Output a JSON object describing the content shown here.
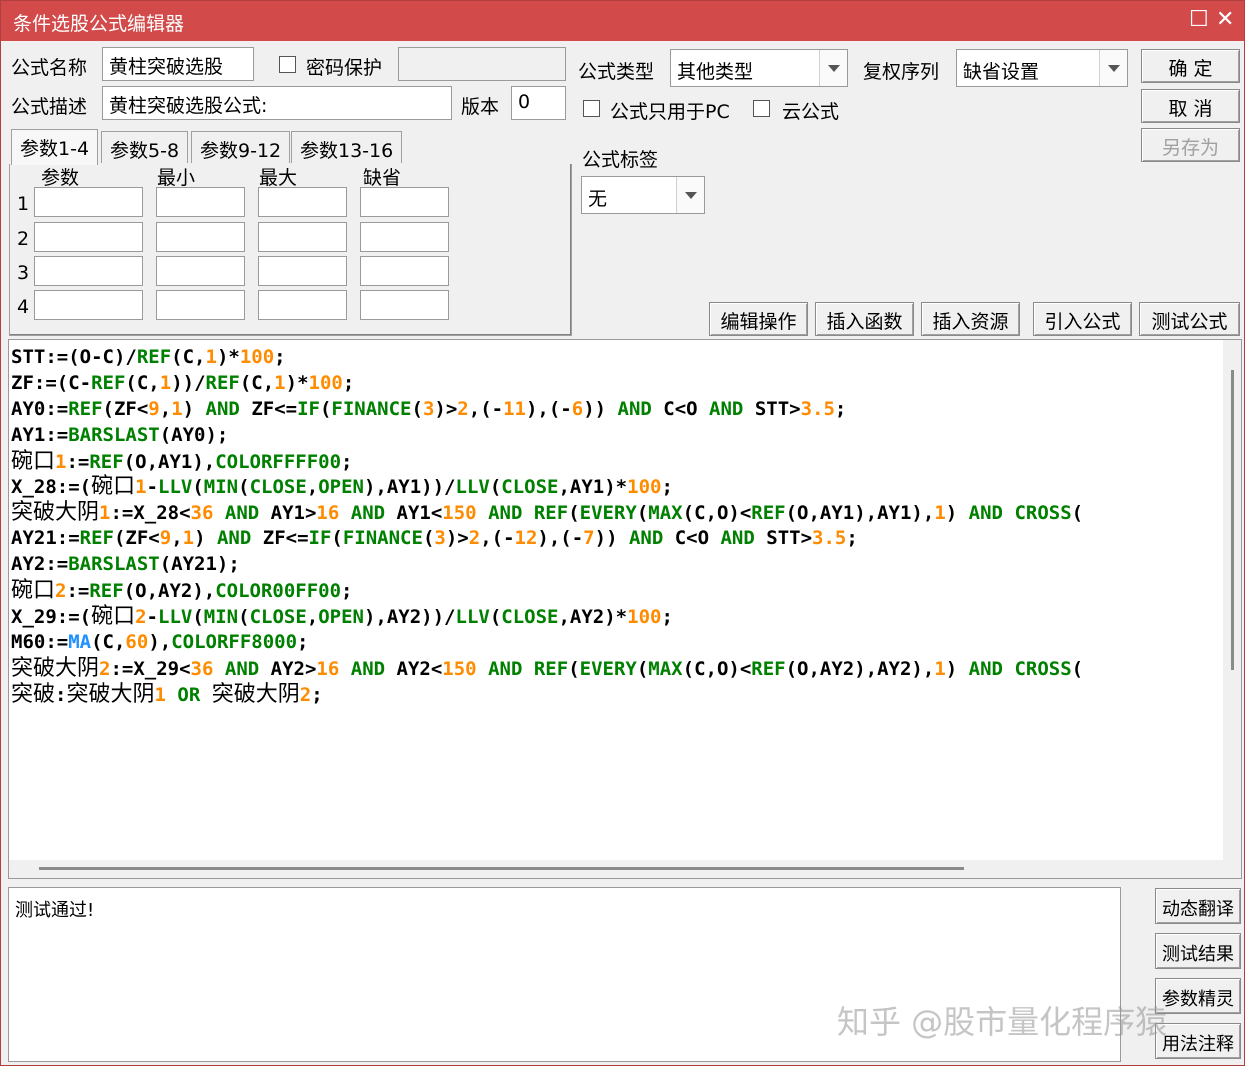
{
  "window": {
    "title": "条件选股公式编辑器"
  },
  "form": {
    "name_label": "公式名称",
    "name_value": "黄柱突破选股",
    "password_label": "密码保护",
    "password_value": "",
    "desc_label": "公式描述",
    "desc_value": "黄柱突破选股公式:",
    "version_label": "版本",
    "version_value": "0",
    "type_label": "公式类型",
    "type_value": "其他类型",
    "adjust_label": "复权序列",
    "adjust_value": "缺省设置",
    "pc_only_label": "公式只用于PC",
    "cloud_label": "云公式",
    "tag_label": "公式标签",
    "tag_value": "无"
  },
  "buttons": {
    "ok": "确  定",
    "cancel": "取  消",
    "save_as": "另存为",
    "edit_ops": "编辑操作",
    "insert_func": "插入函数",
    "insert_res": "插入资源",
    "import_formula": "引入公式",
    "test_formula": "测试公式",
    "dyn_translate": "动态翻译",
    "test_result": "测试结果",
    "param_wizard": "参数精灵",
    "usage_notes": "用法注释"
  },
  "tabs": [
    "参数1-4",
    "参数5-8",
    "参数9-12",
    "参数13-16"
  ],
  "params": {
    "headers": [
      "参数",
      "最小",
      "最大",
      "缺省"
    ],
    "rows": [
      "1",
      "2",
      "3",
      "4"
    ]
  },
  "code_lines": [
    "STT:=(O-C)/REF(C,1)*100;",
    "ZF:=(C-REF(C,1))/REF(C,1)*100;",
    "AY0:=REF(ZF<9,1) AND ZF<=IF(FINANCE(3)>2,(-11),(-6)) AND C<O AND STT>3.5;",
    "AY1:=BARSLAST(AY0);",
    "碗口1:=REF(O,AY1),COLORFFFF00;",
    "X_28:=(碗口1-LLV(MIN(CLOSE,OPEN),AY1))/LLV(CLOSE,AY1)*100;",
    "突破大阴1:=X_28<36 AND AY1>16 AND AY1<150 AND REF(EVERY(MAX(C,O)<REF(O,AY1),AY1),1) AND CROSS(",
    "AY21:=REF(ZF<9,1) AND ZF<=IF(FINANCE(3)>2,(-12),(-7)) AND C<O AND STT>3.5;",
    "AY2:=BARSLAST(AY21);",
    "碗口2:=REF(O,AY2),COLOR00FF00;",
    "X_29:=(碗口2-LLV(MIN(CLOSE,OPEN),AY2))/LLV(CLOSE,AY2)*100;",
    "M60:=MA(C,60),COLORFF8000;",
    "突破大阴2:=X_29<36 AND AY2>16 AND AY2<150 AND REF(EVERY(MAX(C,O)<REF(O,AY2),AY2),1) AND CROSS(",
    "突破:突破大阴1 OR 突破大阴2;"
  ],
  "output": {
    "text": "测试通过!"
  },
  "watermark": "知乎 @股市量化程序猿",
  "colors": {
    "titlebar": "#d24a4a",
    "keyword": "#008000",
    "number": "#ff8c00",
    "function": "#008080"
  }
}
